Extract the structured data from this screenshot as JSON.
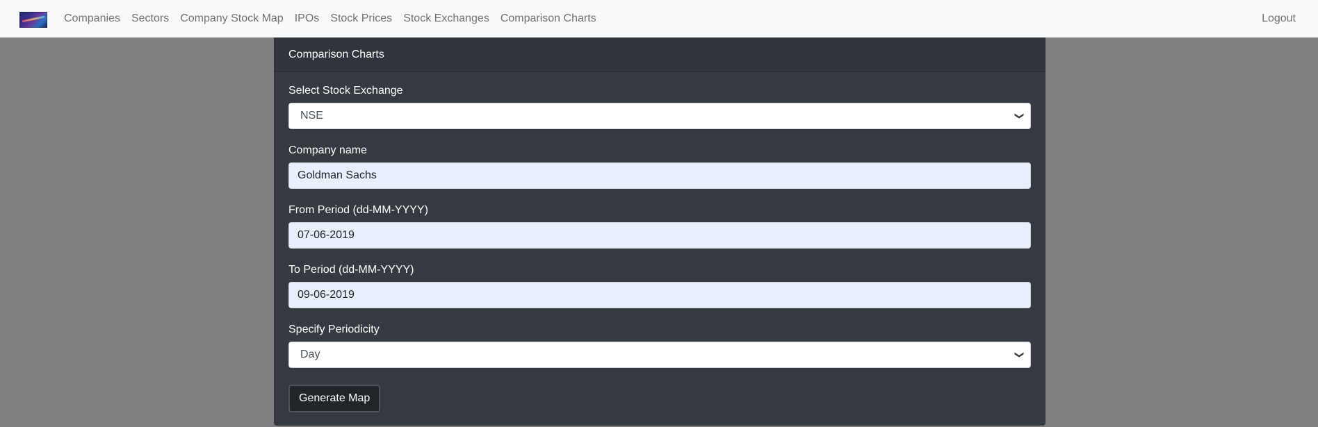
{
  "navbar": {
    "logo": "app-logo",
    "links": [
      "Companies",
      "Sectors",
      "Company Stock Map",
      "IPOs",
      "Stock Prices",
      "Stock Exchanges",
      "Comparison Charts"
    ],
    "logout": "Logout"
  },
  "card": {
    "title": "Comparison Charts",
    "exchange": {
      "label": "Select Stock Exchange",
      "value": "NSE"
    },
    "company": {
      "label": "Company name",
      "value": "Goldman Sachs"
    },
    "from_period": {
      "label": "From Period (dd-MM-YYYY)",
      "value": "07-06-2019"
    },
    "to_period": {
      "label": "To Period (dd-MM-YYYY)",
      "value": "09-06-2019"
    },
    "periodicity": {
      "label": "Specify Periodicity",
      "value": "Day"
    },
    "submit_label": "Generate Map"
  },
  "colors": {
    "page_background": "#808080",
    "navbar_background": "#f8f9fa",
    "card_background": "#343a40",
    "button_background": "#212529",
    "autofill_input": "#e8f0fe"
  }
}
